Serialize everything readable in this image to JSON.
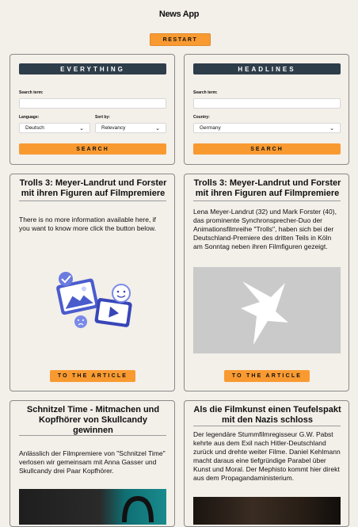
{
  "app": {
    "title": "News App",
    "restart_label": "RESTART"
  },
  "everything": {
    "heading": "EVERYTHING",
    "search_term_label": "Search term:",
    "search_term_value": "",
    "language_label": "Language:",
    "language_value": "Deutsch",
    "sort_label": "Sort by:",
    "sort_value": "Relevancy",
    "search_label": "SEARCH"
  },
  "headlines": {
    "heading": "HEADLINES",
    "search_term_label": "Search term:",
    "search_term_value": "",
    "country_label": "Country:",
    "country_value": "Germany",
    "search_label": "SEARCH"
  },
  "cards": {
    "c1": {
      "title": "Trolls 3: Meyer-Landrut und Forster mit ihren Figuren auf Filmpremiere",
      "text": "There is no more information available here, if you want to know more click the button below.",
      "button": "TO THE ARTICLE"
    },
    "c2": {
      "title": "Trolls 3: Meyer-Landrut und Forster mit ihren Figuren auf Filmpremiere",
      "text": "Lena Meyer-Landrut (32) und Mark Forster (40), das prominente Synchronsprecher-Duo der Animationsfilmreihe \"Trolls\", haben sich bei der Deutschland-Premiere des dritten Teils in Köln am Sonntag neben ihren Filmfiguren gezeigt.",
      "button": "TO THE ARTICLE"
    },
    "c3": {
      "title": "Schnitzel Time - Mitmachen und Kopfhörer von Skullcandy gewinnen",
      "text": "Anlässlich der Filmpremiere von \"Schnitzel Time\" verlosen wir gemeinsam mit Anna Gasser und Skullcandy drei Paar Kopfhörer."
    },
    "c4": {
      "title": "Als die Filmkunst einen Teufelspakt mit den Nazis schloss",
      "text": "Der legendäre Stummfilmregisseur G.W. Pabst kehrte aus dem Exil nach Hitler-Deutschland zurück und drehte weiter Filme. Daniel Kehlmann macht daraus eine tiefgründige Parabel über Kunst und Moral. Der Mephisto kommt hier direkt aus dem Propagandaministerium."
    }
  },
  "colors": {
    "accent": "#f99a31",
    "header_bar": "#2e3d4a",
    "background": "#f3efe9"
  },
  "icons": [
    "chevron-down-icon",
    "media-illustration",
    "broken-image-star-icon"
  ]
}
